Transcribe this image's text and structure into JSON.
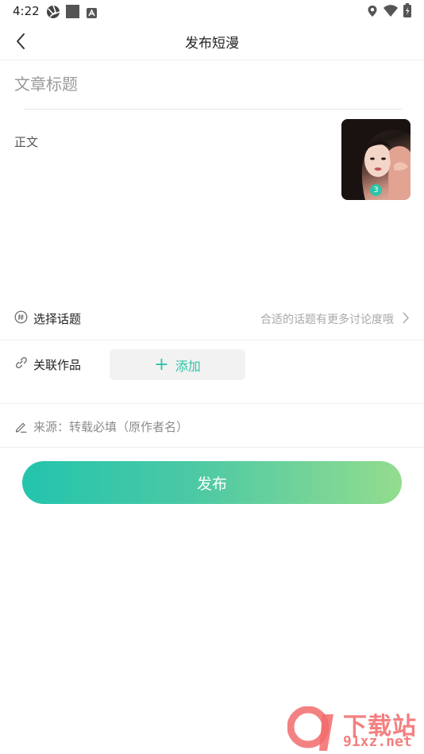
{
  "status_bar": {
    "time": "4:22",
    "left_icons": [
      "aperture-icon",
      "square-icon",
      "a-badge-icon"
    ],
    "right_icons": [
      "location-icon",
      "wifi-icon",
      "battery-icon"
    ]
  },
  "header": {
    "title": "发布短漫",
    "back_icon": "chevron-left-icon"
  },
  "editor": {
    "title_placeholder": "文章标题",
    "body_placeholder": "正文",
    "image_count": "3"
  },
  "topic_row": {
    "label": "选择话题",
    "hint": "合适的话题有更多讨论度哦"
  },
  "related_row": {
    "label": "关联作品",
    "add_label": "添加"
  },
  "source_row": {
    "placeholder": "来源：转载必填（原作者名）"
  },
  "publish": {
    "label": "发布"
  },
  "watermark": {
    "title": "下载站",
    "url": "91xz.net",
    "logo_text": "91"
  },
  "colors": {
    "accent": "#2cc4a8",
    "gradient_start": "#23c4ad",
    "gradient_end": "#93dc8e",
    "hint_text": "#a8a8a8",
    "watermark": "#f26b6b"
  }
}
